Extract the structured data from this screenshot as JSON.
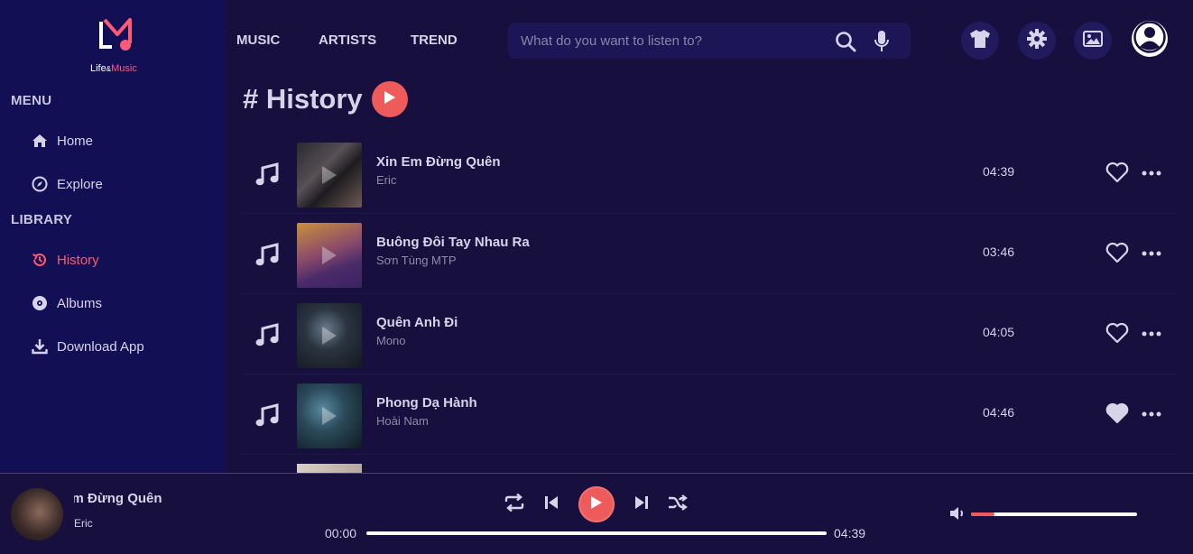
{
  "brand": {
    "logo_text_life": "Life",
    "logo_text_amp": "&",
    "logo_text_music": "Music",
    "accent": "#ef5b5b"
  },
  "sidebar": {
    "menu_title": "MENU",
    "library_title": "LIBRARY",
    "menu_items": [
      {
        "label": "Home",
        "icon": "home-icon"
      },
      {
        "label": "Explore",
        "icon": "compass-icon"
      }
    ],
    "library_items": [
      {
        "label": "History",
        "icon": "history-icon",
        "active": true
      },
      {
        "label": "Albums",
        "icon": "disc-icon"
      },
      {
        "label": "Download App",
        "icon": "download-icon"
      }
    ]
  },
  "topbar": {
    "nav": [
      "MUSIC",
      "ARTISTS",
      "TREND"
    ],
    "search_placeholder": "What do you want to listen to?",
    "icons": [
      "tshirt-icon",
      "gear-icon",
      "image-icon",
      "user-avatar-icon"
    ]
  },
  "page": {
    "title": "# History"
  },
  "tracks": [
    {
      "title": "Xin Em Đừng Quên",
      "artist": "Eric",
      "duration": "04:39",
      "liked": false
    },
    {
      "title": "Buông Đôi Tay Nhau Ra",
      "artist": "Sơn Tùng MTP",
      "duration": "03:46",
      "liked": false
    },
    {
      "title": "Quên Anh Đi",
      "artist": "Mono",
      "duration": "04:05",
      "liked": false
    },
    {
      "title": "Phong Dạ Hành",
      "artist": "Hoài Nam",
      "duration": "04:46",
      "liked": true
    }
  ],
  "player": {
    "title": "Xin Em Đừng Quên",
    "artist": "Eric",
    "current_time": "00:00",
    "total_time": "04:39",
    "progress_fraction": 0.0,
    "volume_fraction": 0.14
  }
}
